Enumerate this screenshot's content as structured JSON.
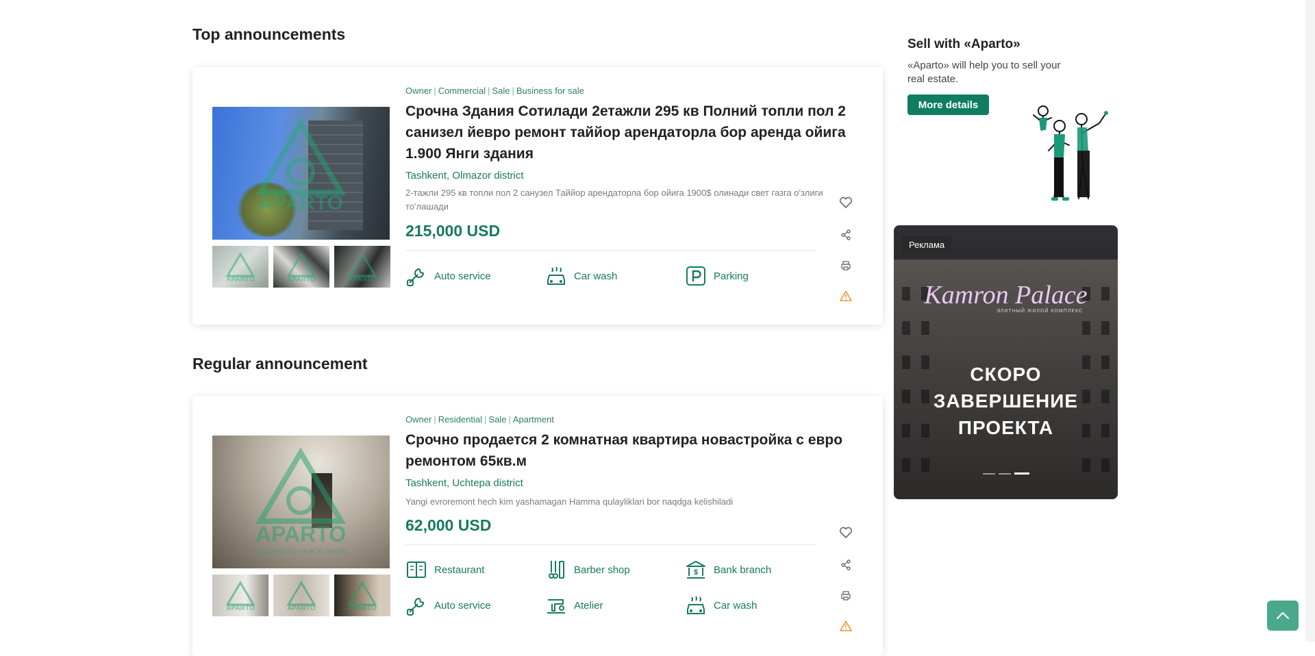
{
  "top_section": {
    "title": "Top announcements"
  },
  "regular_section": {
    "title": "Regular announcement"
  },
  "listings": [
    {
      "tags": [
        "Owner",
        "Commercial",
        "Sale",
        "Business for sale"
      ],
      "title": "Срочна Здания Сотилади 2етажли 295 кв Полний топли пол 2 санизел йевро ремонт таййор арендаторла бор аренда ойига 1.900 Янги здания",
      "location": "Tashkent, Olmazor district",
      "description": "2-тажли 295 кв топли пол 2 санузел Таййор арендаторла бор ойига 1900$ олинади свет газга о'злиги то'лашади",
      "price": "215,000 USD",
      "amenities": [
        {
          "label": "Auto service",
          "icon": "wrench-icon"
        },
        {
          "label": "Car wash",
          "icon": "car-wash-icon"
        },
        {
          "label": "Parking",
          "icon": "parking-icon"
        }
      ]
    },
    {
      "tags": [
        "Owner",
        "Residential",
        "Sale",
        "Apartment"
      ],
      "title": "Срочно продается 2 комнатная квартира новастройка с евро ремонтом 65кв.м",
      "location": "Tashkent, Uchtepa district",
      "description": "Yangi evroremont hech kim yashamagan Hamma qulayliklari bor naqdga kelishiladi",
      "price": "62,000 USD",
      "amenities": [
        {
          "label": "Restaurant",
          "icon": "menu-book-icon"
        },
        {
          "label": "Barber shop",
          "icon": "scissors-comb-icon"
        },
        {
          "label": "Bank branch",
          "icon": "bank-icon"
        },
        {
          "label": "Auto service",
          "icon": "wrench-icon"
        },
        {
          "label": "Atelier",
          "icon": "sewing-machine-icon"
        },
        {
          "label": "Car wash",
          "icon": "car-wash-icon"
        }
      ]
    }
  ],
  "watermark": {
    "brand": "APARTO",
    "tagline": "НАДЁЖНОСТЬ НА ВСЮ ЖИЗНЬ"
  },
  "sidebar": {
    "promo_title": "Sell with «Aparto»",
    "promo_text": "«Aparto» will help you to sell your real estate.",
    "promo_button": "More details"
  },
  "ad": {
    "badge": "Реклама",
    "brand": "Kamron Palace",
    "brand_sub": "ЭЛИТНЫЙ ЖИЛОЙ КОМПЛЕКС",
    "line1": "СКОРО",
    "line2": "ЗАВЕРШЕНИЕ",
    "line3": "ПРОЕКТА",
    "slide_count": 3,
    "active_slide": 3
  },
  "colors": {
    "accent": "#177a5f",
    "button": "#0f7d62",
    "warning": "#e8962e"
  }
}
